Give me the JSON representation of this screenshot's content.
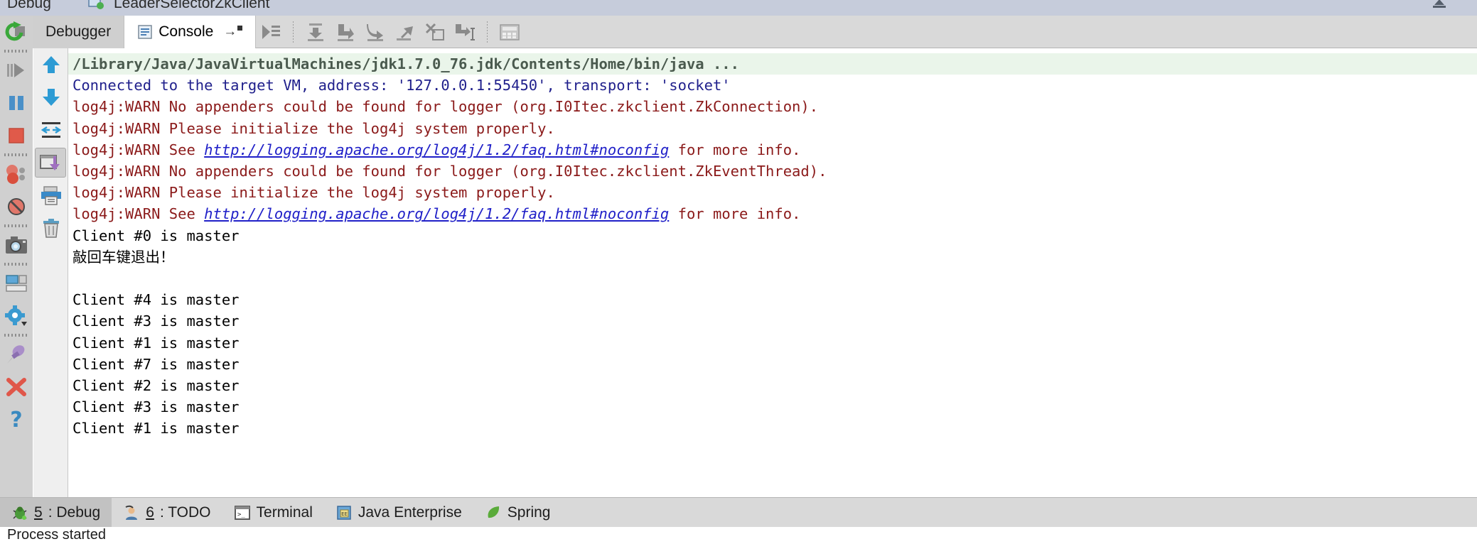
{
  "window": {
    "title_left": "Debug",
    "title_right": "LeaderSelectorZkClient",
    "right_icon": "maximize-icon"
  },
  "toolbar": {
    "tabs": [
      {
        "label": "Debugger",
        "icon": "debugger-icon",
        "active": false
      },
      {
        "label": "Console",
        "icon": "console-icon",
        "active": true
      }
    ],
    "tab_overflow_label": "→",
    "buttons": [
      {
        "name": "show-execution-point-button",
        "icon": "show-execution-point-icon",
        "tooltip": "Show Execution Point"
      },
      {
        "name": "step-over-button",
        "icon": "step-over-icon",
        "tooltip": "Step Over"
      },
      {
        "name": "step-into-button",
        "icon": "step-into-icon",
        "tooltip": "Step Into"
      },
      {
        "name": "force-step-into-button",
        "icon": "force-step-into-icon",
        "tooltip": "Force Step Into"
      },
      {
        "name": "step-out-button",
        "icon": "step-out-icon",
        "tooltip": "Step Out"
      },
      {
        "name": "drop-frame-button",
        "icon": "drop-frame-icon",
        "tooltip": "Drop Frame"
      },
      {
        "name": "run-to-cursor-button",
        "icon": "run-to-cursor-icon",
        "tooltip": "Run to Cursor"
      },
      {
        "name": "evaluate-expression-button",
        "icon": "evaluate-expression-icon",
        "tooltip": "Evaluate Expression"
      }
    ]
  },
  "left_rail": {
    "buttons": [
      {
        "name": "rerun-button",
        "icon": "rerun-icon"
      },
      {
        "name": "resume-program-button",
        "icon": "resume-icon"
      },
      {
        "name": "pause-program-button",
        "icon": "pause-icon"
      },
      {
        "name": "stop-button",
        "icon": "stop-icon"
      },
      {
        "name": "view-breakpoints-button",
        "icon": "breakpoints-icon"
      },
      {
        "name": "mute-breakpoints-button",
        "icon": "mute-breakpoints-icon"
      },
      {
        "name": "get-thread-dump-button",
        "icon": "camera-icon"
      },
      {
        "name": "restore-layout-button",
        "icon": "layout-icon"
      },
      {
        "name": "settings-button",
        "icon": "gear-icon"
      },
      {
        "name": "pin-tab-button",
        "icon": "pin-icon"
      },
      {
        "name": "close-button",
        "icon": "close-x-icon"
      },
      {
        "name": "help-button",
        "icon": "help-question-icon"
      }
    ]
  },
  "console_rail": {
    "buttons": [
      {
        "name": "scroll-up-button",
        "icon": "arrow-up-icon",
        "selected": false
      },
      {
        "name": "scroll-down-button",
        "icon": "arrow-down-icon",
        "selected": false
      },
      {
        "name": "soft-wrap-button",
        "icon": "soft-wrap-icon",
        "selected": false
      },
      {
        "name": "scroll-to-end-button",
        "icon": "scroll-to-end-icon",
        "selected": true
      },
      {
        "name": "print-button",
        "icon": "print-icon",
        "selected": false
      },
      {
        "name": "clear-all-button",
        "icon": "trash-icon",
        "selected": false
      }
    ]
  },
  "console": {
    "lines": [
      {
        "kind": "cmd",
        "text": "/Library/Java/JavaVirtualMachines/jdk1.7.0_76.jdk/Contents/Home/bin/java ..."
      },
      {
        "kind": "sys",
        "text": "Connected to the target VM, address: '127.0.0.1:55450', transport: 'socket'"
      },
      {
        "kind": "warn",
        "text": "log4j:WARN No appenders could be found for logger (org.I0Itec.zkclient.ZkConnection)."
      },
      {
        "kind": "warn",
        "text": "log4j:WARN Please initialize the log4j system properly."
      },
      {
        "kind": "warn-link",
        "prefix": "log4j:WARN See ",
        "link": "http://logging.apache.org/log4j/1.2/faq.html#noconfig",
        "suffix": " for more info."
      },
      {
        "kind": "warn",
        "text": "log4j:WARN No appenders could be found for logger (org.I0Itec.zkclient.ZkEventThread)."
      },
      {
        "kind": "warn",
        "text": "log4j:WARN Please initialize the log4j system properly."
      },
      {
        "kind": "warn-link",
        "prefix": "log4j:WARN See ",
        "link": "http://logging.apache.org/log4j/1.2/faq.html#noconfig",
        "suffix": " for more info."
      },
      {
        "kind": "out",
        "text": "Client #0 is master"
      },
      {
        "kind": "out",
        "text": "敲回车键退出！"
      },
      {
        "kind": "blank",
        "text": ""
      },
      {
        "kind": "out",
        "text": "Client #4 is master"
      },
      {
        "kind": "out",
        "text": "Client #3 is master"
      },
      {
        "kind": "out",
        "text": "Client #1 is master"
      },
      {
        "kind": "out",
        "text": "Client #7 is master"
      },
      {
        "kind": "out",
        "text": "Client #2 is master"
      },
      {
        "kind": "out",
        "text": "Client #3 is master"
      },
      {
        "kind": "out",
        "text": "Client #1 is master"
      }
    ]
  },
  "bottom_bar": {
    "tabs": [
      {
        "num": "5",
        "label": ": Debug",
        "icon": "bug-icon",
        "active": true
      },
      {
        "num": "6",
        "label": ": TODO",
        "icon": "todo-icon",
        "active": false
      },
      {
        "num": "",
        "label": "Terminal",
        "icon": "terminal-icon",
        "active": false
      },
      {
        "num": "",
        "label": "Java Enterprise",
        "icon": "java-enterprise-icon",
        "active": false
      },
      {
        "num": "",
        "label": "Spring",
        "icon": "spring-leaf-icon",
        "active": false
      }
    ]
  },
  "status_bar": {
    "message": "Process started"
  },
  "colors": {
    "cmd_text": "#4a5a4e",
    "cmd_background": "#eaf5ea",
    "system_text": "#20208c",
    "warn_text": "#8b1a1a",
    "link_text": "#2020c8",
    "stdout_text": "#000000",
    "toolbar_background": "#d9d9d9",
    "title_background": "#c6ccdb"
  }
}
